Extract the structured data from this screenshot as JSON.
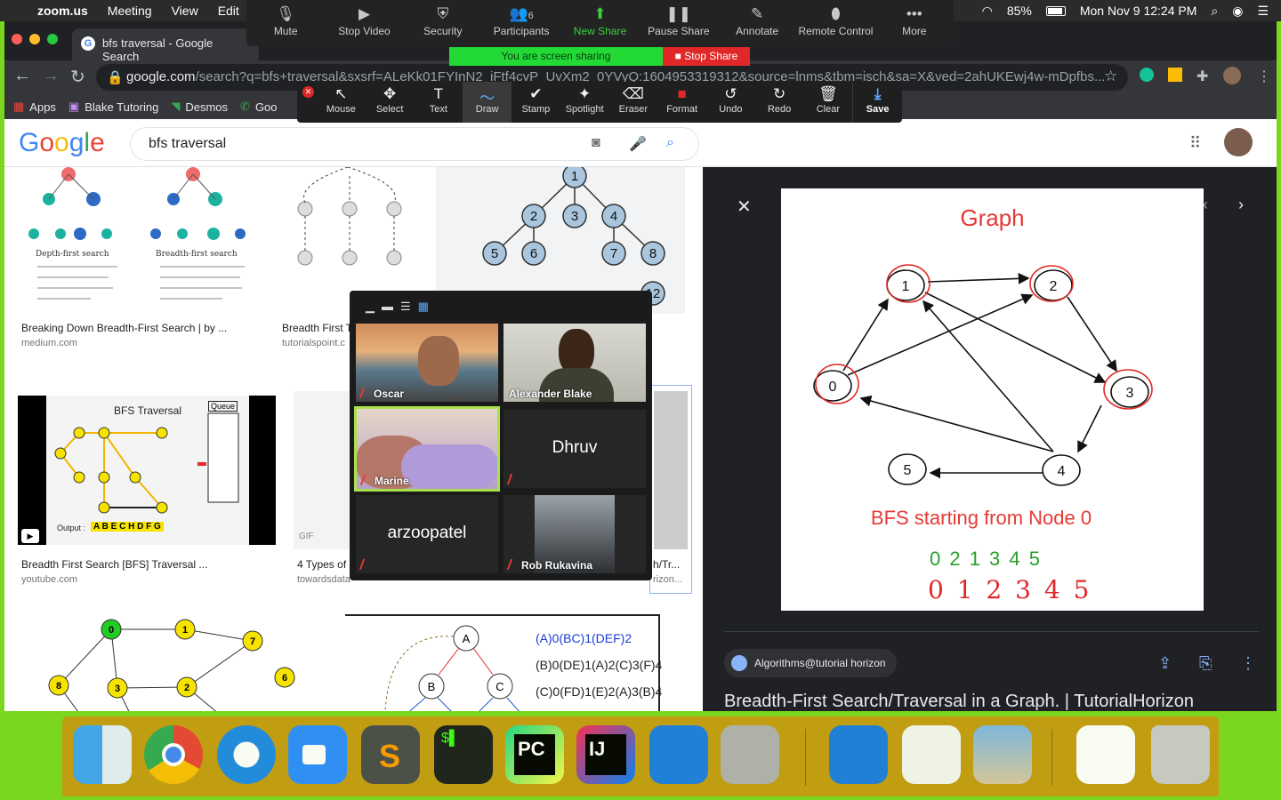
{
  "menubar": {
    "apple": "",
    "app_name": "zoom.us",
    "items": [
      "Meeting",
      "View",
      "Edit"
    ],
    "battery": "85%",
    "datetime": "Mon Nov 9  12:24 PM"
  },
  "zoom_toolbar": {
    "buttons": [
      {
        "label": "Mute",
        "icon": "mic-icon"
      },
      {
        "label": "Stop Video",
        "icon": "video-icon"
      },
      {
        "label": "Security",
        "icon": "shield-icon"
      },
      {
        "label": "Participants",
        "icon": "people-icon",
        "count": "6"
      },
      {
        "label": "New Share",
        "icon": "share-icon"
      },
      {
        "label": "Pause Share",
        "icon": "pause-icon"
      },
      {
        "label": "Annotate",
        "icon": "pencil-icon"
      },
      {
        "label": "Remote Control",
        "icon": "mouse-icon"
      },
      {
        "label": "More",
        "icon": "more-icon"
      }
    ],
    "sharing_status": "You are screen sharing",
    "stop_share": "Stop Share"
  },
  "annotate_toolbar": {
    "tools": [
      {
        "label": "Mouse",
        "glyph": "↖"
      },
      {
        "label": "Select",
        "glyph": "✥"
      },
      {
        "label": "Text",
        "glyph": "T"
      },
      {
        "label": "Draw",
        "glyph": "〜"
      },
      {
        "label": "Stamp",
        "glyph": "✔"
      },
      {
        "label": "Spotlight",
        "glyph": "✦"
      },
      {
        "label": "Eraser",
        "glyph": "⌫"
      },
      {
        "label": "Format",
        "glyph": "■"
      },
      {
        "label": "Undo",
        "glyph": "↺"
      },
      {
        "label": "Redo",
        "glyph": "↻"
      },
      {
        "label": "Clear",
        "glyph": "🗑"
      },
      {
        "label": "Save",
        "glyph": "⤓"
      }
    ],
    "selected": "Draw"
  },
  "browser": {
    "tab_title": "bfs traversal - Google Search",
    "url_host": "google.com",
    "url_rest": "/search?q=bfs+traversal&sxsrf=ALeKk01FYInN2_iFtf4cvP_UvXm2_0YVyQ:1604953319312&source=lnms&tbm=isch&sa=X&ved=2ahUKEwj4w-mDpfbs...",
    "bookmarks": [
      "Apps",
      "Blake Tutoring",
      "Desmos",
      "Goo"
    ]
  },
  "google": {
    "logo": "Google",
    "query": "bfs traversal"
  },
  "results": [
    {
      "caption": "Breaking Down Breadth-First Search | by ...",
      "source": "medium.com"
    },
    {
      "caption": "Breadth First T",
      "source": "tutorialspoint.c"
    },
    {
      "caption": "Breadth First Search [BFS] Traversal ...",
      "source": "youtube.com"
    },
    {
      "caption": "4 Types of",
      "source": "towardsdata"
    },
    {
      "caption": "h/Tr...",
      "source": "rizon..."
    }
  ],
  "thumb_texts": {
    "dfs": "Depth-first search",
    "bfs": "Breadth-first search",
    "yt_title": "BFS Traversal",
    "yt_queue": "Queue",
    "yt_output_label": "Output :",
    "yt_output": "A B E C H D F G",
    "gif": "GIF",
    "eq1": "(A)0(BC)1(DEF)2",
    "eq2": "(B)0(DE)1(A)2(C)3(F)4",
    "eq3": "(C)0(FD)1(E)2(A)3(B)4"
  },
  "panel": {
    "graph_title": "Graph",
    "graph_subtitle": "BFS starting from Node 0",
    "sequence_printed": "0 2 1 3 4 5",
    "sequence_handwritten": "0 1 2 3 4 5",
    "source_name": "Algorithms@tutorial horizon",
    "result_title": "Breadth-First Search/Traversal in a Graph. | TutorialHorizon",
    "node_labels": [
      "0",
      "1",
      "2",
      "3",
      "4",
      "5"
    ]
  },
  "gallery": {
    "participants": [
      "Oscar",
      "Alexander Blake",
      "Marine",
      "Dhruv",
      "arzoopatel",
      "Rob Rukavina"
    ]
  },
  "colors": {
    "share_border": "#7bd61e",
    "zoom_green": "#23d936",
    "stop_red": "#e02828",
    "dock": "#c59b12"
  }
}
